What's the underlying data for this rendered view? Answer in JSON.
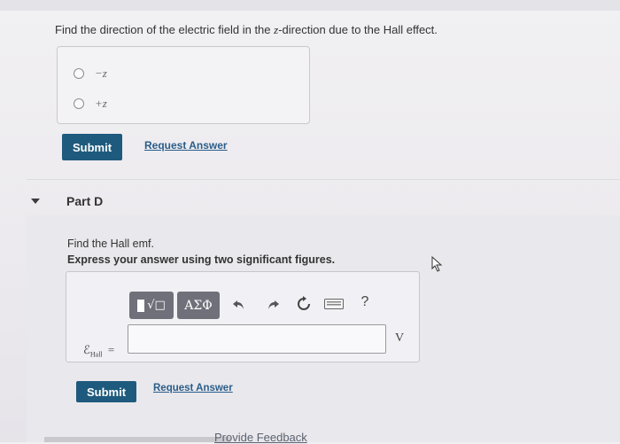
{
  "question": {
    "prefix": "Find the direction of the electric field in the ",
    "var": "z",
    "suffix": "-direction due to the Hall effect."
  },
  "choices": [
    {
      "label": "−z"
    },
    {
      "label": "+z"
    }
  ],
  "part_c": {
    "submit_label": "Submit",
    "request_label": "Request Answer"
  },
  "part_d": {
    "title": "Part D",
    "question": "Find the Hall emf.",
    "instruction": "Express your answer using two significant figures.",
    "toolbar": {
      "template_label": "√□",
      "greek_label": "ΑΣΦ",
      "help_label": "?"
    },
    "var_main": "ℰ",
    "var_sub": "Hall",
    "equals": "=",
    "answer_value": "",
    "units": "V",
    "submit_label": "Submit",
    "request_label": "Request Answer"
  },
  "feedback_label": "Provide Feedback"
}
